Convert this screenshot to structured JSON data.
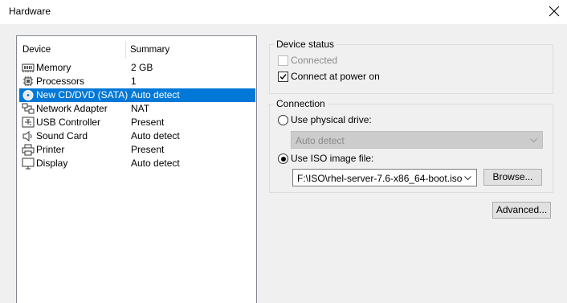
{
  "window": {
    "title": "Hardware"
  },
  "device_list": {
    "headers": {
      "device": "Device",
      "summary": "Summary"
    },
    "items": [
      {
        "icon": "memory-icon",
        "name": "Memory",
        "summary": "2 GB"
      },
      {
        "icon": "processor-icon",
        "name": "Processors",
        "summary": "1"
      },
      {
        "icon": "cd-dvd-icon",
        "name": "New CD/DVD (SATA)",
        "summary": "Auto detect",
        "selected": true
      },
      {
        "icon": "network-adapter-icon",
        "name": "Network Adapter",
        "summary": "NAT"
      },
      {
        "icon": "usb-controller-icon",
        "name": "USB Controller",
        "summary": "Present"
      },
      {
        "icon": "sound-card-icon",
        "name": "Sound Card",
        "summary": "Auto detect"
      },
      {
        "icon": "printer-icon",
        "name": "Printer",
        "summary": "Present"
      },
      {
        "icon": "display-icon",
        "name": "Display",
        "summary": "Auto detect"
      }
    ]
  },
  "device_status": {
    "title": "Device status",
    "connected": {
      "label": "Connected",
      "checked": false,
      "enabled": false
    },
    "connect_at_power_on": {
      "label": "Connect at power on",
      "checked": true,
      "enabled": true
    }
  },
  "connection": {
    "title": "Connection",
    "use_physical_drive": {
      "label": "Use physical drive:",
      "selected": false
    },
    "physical_drive_value": "Auto detect",
    "use_iso_image": {
      "label": "Use ISO image file:",
      "selected": true
    },
    "iso_path": "F:\\ISO\\rhel-server-7.6-x86_64-boot.iso",
    "browse_label": "Browse..."
  },
  "advanced_label": "Advanced...",
  "colors": {
    "selection": "#0078d7",
    "dialog_bg": "#f0f0f0"
  }
}
